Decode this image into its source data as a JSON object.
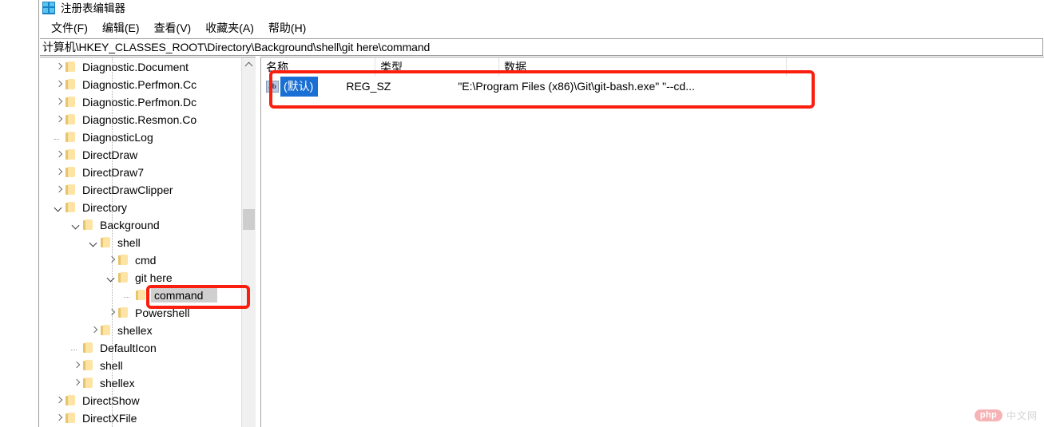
{
  "window": {
    "title": "注册表编辑器",
    "icon": "registry-editor-icon"
  },
  "menubar": {
    "items": [
      {
        "label": "文件(F)",
        "accel": "F"
      },
      {
        "label": "编辑(E)",
        "accel": "E"
      },
      {
        "label": "查看(V)",
        "accel": "V"
      },
      {
        "label": "收藏夹(A)",
        "accel": "A"
      },
      {
        "label": "帮助(H)",
        "accel": "H"
      }
    ]
  },
  "address": {
    "path": "计算机\\HKEY_CLASSES_ROOT\\Directory\\Background\\shell\\git here\\command"
  },
  "tree": {
    "scroll_up_icon": "chevron-up-icon",
    "nodes": [
      {
        "label": "Diagnostic.Document",
        "depth": 1,
        "state": "closed",
        "selected": false
      },
      {
        "label": "Diagnostic.Perfmon.Cc",
        "depth": 1,
        "state": "closed",
        "selected": false
      },
      {
        "label": "Diagnostic.Perfmon.Dc",
        "depth": 1,
        "state": "closed",
        "selected": false
      },
      {
        "label": "Diagnostic.Resmon.Co",
        "depth": 1,
        "state": "closed",
        "selected": false
      },
      {
        "label": "DiagnosticLog",
        "depth": 1,
        "state": "leaf",
        "selected": false
      },
      {
        "label": "DirectDraw",
        "depth": 1,
        "state": "closed",
        "selected": false
      },
      {
        "label": "DirectDraw7",
        "depth": 1,
        "state": "closed",
        "selected": false
      },
      {
        "label": "DirectDrawClipper",
        "depth": 1,
        "state": "closed",
        "selected": false
      },
      {
        "label": "Directory",
        "depth": 1,
        "state": "open",
        "selected": false
      },
      {
        "label": "Background",
        "depth": 2,
        "state": "open",
        "selected": false
      },
      {
        "label": "shell",
        "depth": 3,
        "state": "open",
        "selected": false
      },
      {
        "label": "cmd",
        "depth": 4,
        "state": "closed",
        "selected": false
      },
      {
        "label": "git here",
        "depth": 4,
        "state": "open",
        "selected": false
      },
      {
        "label": "command",
        "depth": 5,
        "state": "leaf",
        "selected": true
      },
      {
        "label": "Powershell",
        "depth": 4,
        "state": "closed",
        "selected": false
      },
      {
        "label": "shellex",
        "depth": 3,
        "state": "closed",
        "selected": false
      },
      {
        "label": "DefaultIcon",
        "depth": 2,
        "state": "leaf",
        "selected": false
      },
      {
        "label": "shell",
        "depth": 2,
        "state": "closed",
        "selected": false
      },
      {
        "label": "shellex",
        "depth": 2,
        "state": "closed",
        "selected": false
      },
      {
        "label": "DirectShow",
        "depth": 1,
        "state": "closed",
        "selected": false
      },
      {
        "label": "DirectXFile",
        "depth": 1,
        "state": "closed",
        "selected": false
      }
    ]
  },
  "list": {
    "columns": [
      "名称",
      "类型",
      "数据"
    ],
    "rows": [
      {
        "icon": "string-value-icon",
        "icon_text": "ab",
        "name": "(默认)",
        "type": "REG_SZ",
        "data": "\"E:\\Program Files (x86)\\Git\\git-bash.exe\" \"--cd...",
        "selected": true
      }
    ]
  },
  "annotations": {
    "highlight_color": "#fa1e0e",
    "boxes": [
      "tree-command-highlight",
      "list-default-value-highlight"
    ]
  },
  "watermark": {
    "logo": "php",
    "text": "中文网"
  }
}
